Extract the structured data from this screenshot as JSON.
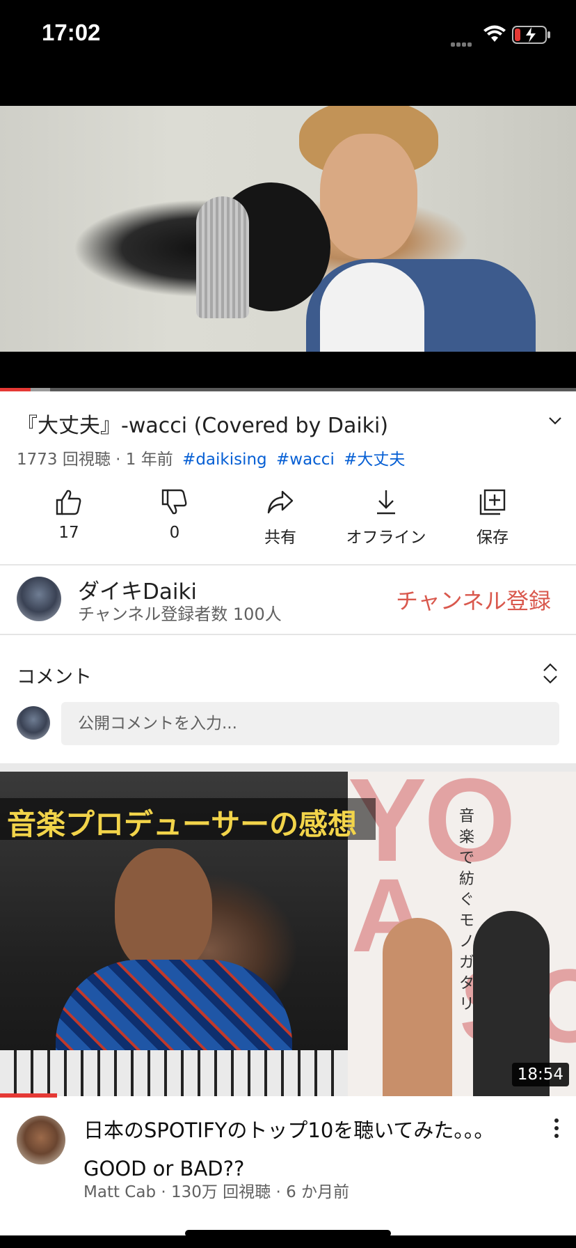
{
  "status_bar": {
    "time": "17:02"
  },
  "player": {
    "progress_fraction": 0.053,
    "buffered_fraction": 0.087
  },
  "video": {
    "title": "『大丈夫』-wacci (Covered by Daiki)",
    "meta": "1773 回視聴 · 1 年前",
    "tags": [
      "#daikising",
      "#wacci",
      "#大丈夫"
    ]
  },
  "actions": {
    "like": "17",
    "dislike": "0",
    "share": "共有",
    "offline": "オフライン",
    "save": "保存"
  },
  "channel": {
    "name": "ダイキDaiki",
    "subscribers": "チャンネル登録者数 100人",
    "subscribe_label": "チャンネル登録"
  },
  "comments": {
    "label": "コメント",
    "placeholder": "公開コメントを入力..."
  },
  "recommended": {
    "thumbnail_overlay": "音楽プロデューサーの感想",
    "thumbnail_vertical_text": "音楽で紡ぐモノガタリ",
    "thumbnail_big_text_1": "YO",
    "thumbnail_big_text_2": "A",
    "thumbnail_big_text_3": "SO",
    "duration": "18:54",
    "title": "日本のSPOTIFYのトップ10を聴いてみた。。。GOOD or BAD??",
    "meta": "Matt Cab · 130万 回視聴 · 6 か月前"
  },
  "colors": {
    "accent_red": "#e53935",
    "subscribe_text": "#d9584d",
    "hashtag_blue": "#065fd4"
  }
}
